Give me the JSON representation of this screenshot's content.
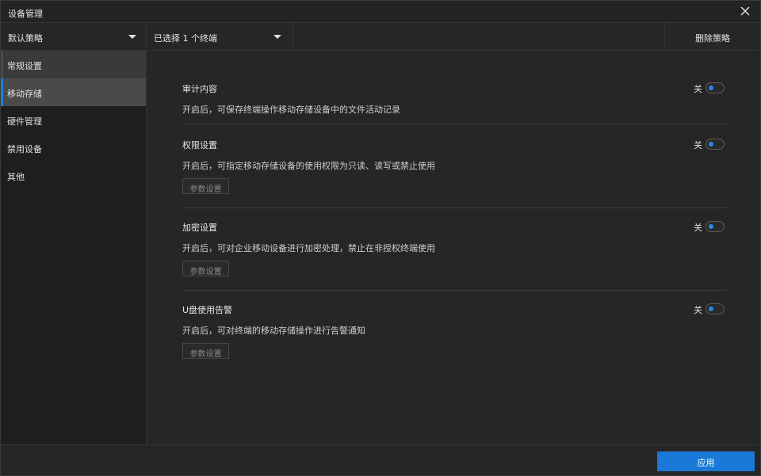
{
  "window": {
    "title": "设备管理"
  },
  "toolbar": {
    "policy_select": "默认策略",
    "terminal_select": "已选择 1 个终端",
    "delete_label": "删除策略"
  },
  "sidebar": {
    "items": [
      {
        "label": "常规设置",
        "state": "hover"
      },
      {
        "label": "移动存储",
        "state": "active"
      },
      {
        "label": "硬件管理",
        "state": "normal"
      },
      {
        "label": "禁用设备",
        "state": "normal"
      },
      {
        "label": "其他",
        "state": "normal"
      }
    ]
  },
  "sections": [
    {
      "title": "审计内容",
      "toggle_label": "关",
      "desc": "开启后，可保存终端操作移动存储设备中的文件活动记录"
    },
    {
      "title": "权限设置",
      "toggle_label": "关",
      "desc": "开启后，可指定移动存储设备的使用权限为只读、读写或禁止使用",
      "param_label": "参数设置"
    },
    {
      "title": "加密设置",
      "toggle_label": "关",
      "desc": "开启后，可对企业移动设备进行加密处理，禁止在非授权终端使用",
      "param_label": "参数设置"
    },
    {
      "title": "U盘使用告警",
      "toggle_label": "关",
      "desc": "开启后，可对终端的移动存储操作进行告警通知",
      "param_label": "参数设置"
    }
  ],
  "footer": {
    "apply_label": "应用"
  },
  "colors": {
    "accent": "#1a78d6",
    "background": "#262626",
    "sidebar": "#1e1e1e"
  },
  "icons": {
    "close": "close-icon",
    "dropdown": "caret-down-icon"
  }
}
